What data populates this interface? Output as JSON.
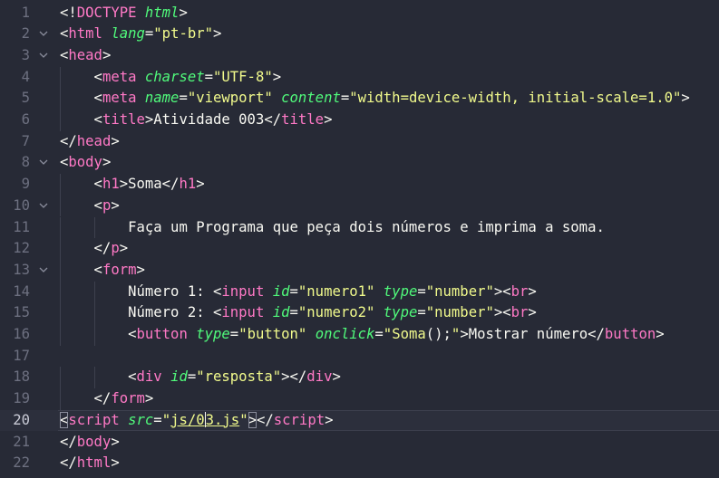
{
  "editor": {
    "line_numbers": [
      "1",
      "2",
      "3",
      "4",
      "5",
      "6",
      "7",
      "8",
      "9",
      "10",
      "11",
      "12",
      "13",
      "14",
      "15",
      "16",
      "17",
      "18",
      "19",
      "20",
      "21",
      "22"
    ],
    "fold_icon": "chevron-down-icon",
    "current_line": "20",
    "lines": {
      "l1": [
        "<!",
        "DOCTYPE",
        " ",
        "html",
        ">"
      ],
      "l2": [
        "<",
        "html",
        " ",
        "lang",
        "=",
        "\"pt-br\"",
        ">"
      ],
      "l3": [
        "<",
        "head",
        ">"
      ],
      "l4": [
        "<",
        "meta",
        " ",
        "charset",
        "=",
        "\"UTF-8\"",
        ">"
      ],
      "l5": [
        "<",
        "meta",
        " ",
        "name",
        "=",
        "\"viewport\"",
        " ",
        "content",
        "=",
        "\"width=device-width, initial-scale=1.0\"",
        ">"
      ],
      "l6": [
        "<",
        "title",
        ">",
        "Atividade 003",
        "</",
        "title",
        ">"
      ],
      "l7": [
        "</",
        "head",
        ">"
      ],
      "l8": [
        "<",
        "body",
        ">"
      ],
      "l9": [
        "<",
        "h1",
        ">",
        "Soma",
        "</",
        "h1",
        ">"
      ],
      "l10": [
        "<",
        "p",
        ">"
      ],
      "l11": [
        "Faça um Programa que peça dois números e imprima a soma."
      ],
      "l12": [
        "</",
        "p",
        ">"
      ],
      "l13": [
        "<",
        "form",
        ">"
      ],
      "l14": [
        "Número 1: ",
        "<",
        "input",
        " ",
        "id",
        "=",
        "\"numero1\"",
        " ",
        "type",
        "=",
        "\"number\"",
        ">",
        "<",
        "br",
        ">"
      ],
      "l15": [
        "Número 2: ",
        "<",
        "input",
        " ",
        "id",
        "=",
        "\"numero2\"",
        " ",
        "type",
        "=",
        "\"number\"",
        ">",
        "<",
        "br",
        ">"
      ],
      "l16": [
        "<",
        "button",
        " ",
        "type",
        "=",
        "\"button\"",
        " ",
        "onclick",
        "=",
        "\"",
        "Soma",
        "()",
        ";",
        "\"",
        ">",
        "Mostrar número",
        "</",
        "button",
        ">"
      ],
      "l17": [
        ""
      ],
      "l18": [
        "<",
        "div",
        " ",
        "id",
        "=",
        "\"resposta\"",
        ">",
        "</",
        "div",
        ">"
      ],
      "l19": [
        "</",
        "form",
        ">"
      ],
      "l20": [
        "<",
        "script",
        " ",
        "src",
        "=",
        "\"",
        "js/0",
        "3.js",
        "\"",
        ">",
        "</",
        "script",
        ">"
      ],
      "l21": [
        "</",
        "body",
        ">"
      ],
      "l22": [
        "</",
        "html",
        ">"
      ]
    }
  }
}
